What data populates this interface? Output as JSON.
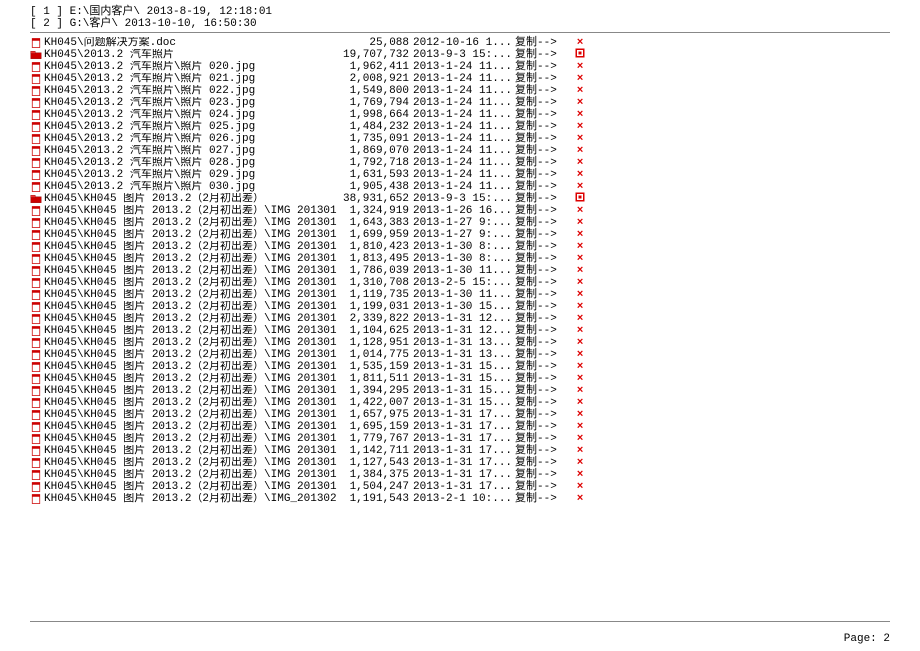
{
  "header": [
    "[ 1 ] E:\\国内客户\\ 2013-8-19, 12:18:01",
    "[ 2 ] G:\\客户\\ 2013-10-10, 16:50:30"
  ],
  "action": "复制-->",
  "footer": "Page: 2",
  "rows": [
    {
      "icon": "file",
      "f": 0,
      "name": "KH045\\问题解决方案.doc",
      "size": "25,088",
      "date": "2012-10-16 1...",
      "mark": "x"
    },
    {
      "icon": "folder",
      "f": 1,
      "name": "KH045\\2013.2 汽车照片",
      "size": "19,707,732",
      "date": "2013-9-3 15:...",
      "mark": "sp"
    },
    {
      "icon": "file",
      "f": 0,
      "name": "KH045\\2013.2 汽车照片\\照片 020.jpg",
      "size": "1,962,411",
      "date": "2013-1-24 11...",
      "mark": "x"
    },
    {
      "icon": "file",
      "f": 0,
      "name": "KH045\\2013.2 汽车照片\\照片 021.jpg",
      "size": "2,008,921",
      "date": "2013-1-24 11...",
      "mark": "x"
    },
    {
      "icon": "file",
      "f": 0,
      "name": "KH045\\2013.2 汽车照片\\照片 022.jpg",
      "size": "1,549,800",
      "date": "2013-1-24 11...",
      "mark": "x"
    },
    {
      "icon": "file",
      "f": 0,
      "name": "KH045\\2013.2 汽车照片\\照片 023.jpg",
      "size": "1,769,794",
      "date": "2013-1-24 11...",
      "mark": "x"
    },
    {
      "icon": "file",
      "f": 0,
      "name": "KH045\\2013.2 汽车照片\\照片 024.jpg",
      "size": "1,998,664",
      "date": "2013-1-24 11...",
      "mark": "x"
    },
    {
      "icon": "file",
      "f": 0,
      "name": "KH045\\2013.2 汽车照片\\照片 025.jpg",
      "size": "1,484,232",
      "date": "2013-1-24 11...",
      "mark": "x"
    },
    {
      "icon": "file",
      "f": 0,
      "name": "KH045\\2013.2 汽车照片\\照片 026.jpg",
      "size": "1,735,091",
      "date": "2013-1-24 11...",
      "mark": "x"
    },
    {
      "icon": "file",
      "f": 0,
      "name": "KH045\\2013.2 汽车照片\\照片 027.jpg",
      "size": "1,869,070",
      "date": "2013-1-24 11...",
      "mark": "x"
    },
    {
      "icon": "file",
      "f": 0,
      "name": "KH045\\2013.2 汽车照片\\照片 028.jpg",
      "size": "1,792,718",
      "date": "2013-1-24 11...",
      "mark": "x"
    },
    {
      "icon": "file",
      "f": 0,
      "name": "KH045\\2013.2 汽车照片\\照片 029.jpg",
      "size": "1,631,593",
      "date": "2013-1-24 11...",
      "mark": "x"
    },
    {
      "icon": "file",
      "f": 0,
      "name": "KH045\\2013.2 汽车照片\\照片 030.jpg",
      "size": "1,905,438",
      "date": "2013-1-24 11...",
      "mark": "x"
    },
    {
      "icon": "folder",
      "f": 1,
      "name": "KH045\\KH045 图片 2013.2（2月初出差）",
      "size": "38,931,652",
      "date": "2013-9-3 15:...",
      "mark": "sp"
    },
    {
      "icon": "file",
      "f": 0,
      "name": "KH045\\KH045 图片 2013.2（2月初出差）\\IMG 201301:",
      "size": "1,324,919",
      "date": "2013-1-26 16...",
      "mark": "x"
    },
    {
      "icon": "file",
      "f": 0,
      "name": "KH045\\KH045 图片 2013.2（2月初出差）\\IMG 201301:",
      "size": "1,643,383",
      "date": "2013-1-27 9:...",
      "mark": "x"
    },
    {
      "icon": "file",
      "f": 0,
      "name": "KH045\\KH045 图片 2013.2（2月初出差）\\IMG 201301:",
      "size": "1,699,959",
      "date": "2013-1-27 9:...",
      "mark": "x"
    },
    {
      "icon": "file",
      "f": 0,
      "name": "KH045\\KH045 图片 2013.2（2月初出差）\\IMG 201301:",
      "size": "1,810,423",
      "date": "2013-1-30 8:...",
      "mark": "x"
    },
    {
      "icon": "file",
      "f": 0,
      "name": "KH045\\KH045 图片 2013.2（2月初出差）\\IMG 201301:",
      "size": "1,813,495",
      "date": "2013-1-30 8:...",
      "mark": "x"
    },
    {
      "icon": "file",
      "f": 0,
      "name": "KH045\\KH045 图片 2013.2（2月初出差）\\IMG 201301:",
      "size": "1,786,039",
      "date": "2013-1-30 11...",
      "mark": "x"
    },
    {
      "icon": "file",
      "f": 0,
      "name": "KH045\\KH045 图片 2013.2（2月初出差）\\IMG 201301:",
      "size": "1,310,708",
      "date": "2013-2-5 15:...",
      "mark": "x"
    },
    {
      "icon": "file",
      "f": 0,
      "name": "KH045\\KH045 图片 2013.2（2月初出差）\\IMG 201301:",
      "size": "1,119,735",
      "date": "2013-1-30 11...",
      "mark": "x"
    },
    {
      "icon": "file",
      "f": 0,
      "name": "KH045\\KH045 图片 2013.2（2月初出差）\\IMG 201301:",
      "size": "1,199,031",
      "date": "2013-1-30 15...",
      "mark": "x"
    },
    {
      "icon": "file",
      "f": 0,
      "name": "KH045\\KH045 图片 2013.2（2月初出差）\\IMG 201301:",
      "size": "2,339,822",
      "date": "2013-1-31 12...",
      "mark": "x"
    },
    {
      "icon": "file",
      "f": 0,
      "name": "KH045\\KH045 图片 2013.2（2月初出差）\\IMG 201301:",
      "size": "1,104,625",
      "date": "2013-1-31 12...",
      "mark": "x"
    },
    {
      "icon": "file",
      "f": 0,
      "name": "KH045\\KH045 图片 2013.2（2月初出差）\\IMG 201301:",
      "size": "1,128,951",
      "date": "2013-1-31 13...",
      "mark": "x"
    },
    {
      "icon": "file",
      "f": 0,
      "name": "KH045\\KH045 图片 2013.2（2月初出差）\\IMG 201301:",
      "size": "1,014,775",
      "date": "2013-1-31 13...",
      "mark": "x"
    },
    {
      "icon": "file",
      "f": 0,
      "name": "KH045\\KH045 图片 2013.2（2月初出差）\\IMG 201301:",
      "size": "1,535,159",
      "date": "2013-1-31 15...",
      "mark": "x"
    },
    {
      "icon": "file",
      "f": 0,
      "name": "KH045\\KH045 图片 2013.2（2月初出差）\\IMG 201301:",
      "size": "1,811,511",
      "date": "2013-1-31 15...",
      "mark": "x"
    },
    {
      "icon": "file",
      "f": 0,
      "name": "KH045\\KH045 图片 2013.2（2月初出差）\\IMG 201301:",
      "size": "1,394,295",
      "date": "2013-1-31 15...",
      "mark": "x"
    },
    {
      "icon": "file",
      "f": 0,
      "name": "KH045\\KH045 图片 2013.2（2月初出差）\\IMG 201301:",
      "size": "1,422,007",
      "date": "2013-1-31 15...",
      "mark": "x"
    },
    {
      "icon": "file",
      "f": 0,
      "name": "KH045\\KH045 图片 2013.2（2月初出差）\\IMG 201301:",
      "size": "1,657,975",
      "date": "2013-1-31 17...",
      "mark": "x"
    },
    {
      "icon": "file",
      "f": 0,
      "name": "KH045\\KH045 图片 2013.2（2月初出差）\\IMG 201301:",
      "size": "1,695,159",
      "date": "2013-1-31 17...",
      "mark": "x"
    },
    {
      "icon": "file",
      "f": 0,
      "name": "KH045\\KH045 图片 2013.2（2月初出差）\\IMG 201301:",
      "size": "1,779,767",
      "date": "2013-1-31 17...",
      "mark": "x"
    },
    {
      "icon": "file",
      "f": 0,
      "name": "KH045\\KH045 图片 2013.2（2月初出差）\\IMG 201301:",
      "size": "1,142,711",
      "date": "2013-1-31 17...",
      "mark": "x"
    },
    {
      "icon": "file",
      "f": 0,
      "name": "KH045\\KH045 图片 2013.2（2月初出差）\\IMG 201301:",
      "size": "1,127,543",
      "date": "2013-1-31 17...",
      "mark": "x"
    },
    {
      "icon": "file",
      "f": 0,
      "name": "KH045\\KH045 图片 2013.2（2月初出差）\\IMG 201301:",
      "size": "1,384,375",
      "date": "2013-1-31 17...",
      "mark": "x"
    },
    {
      "icon": "file",
      "f": 0,
      "name": "KH045\\KH045 图片 2013.2（2月初出差）\\IMG 201301:",
      "size": "1,504,247",
      "date": "2013-1-31 17...",
      "mark": "x"
    },
    {
      "icon": "file",
      "f": 0,
      "name": "KH045\\KH045 图片 2013.2（2月初出差）\\IMG_201302(",
      "size": "1,191,543",
      "date": "2013-2-1 10:...",
      "mark": "x"
    }
  ]
}
